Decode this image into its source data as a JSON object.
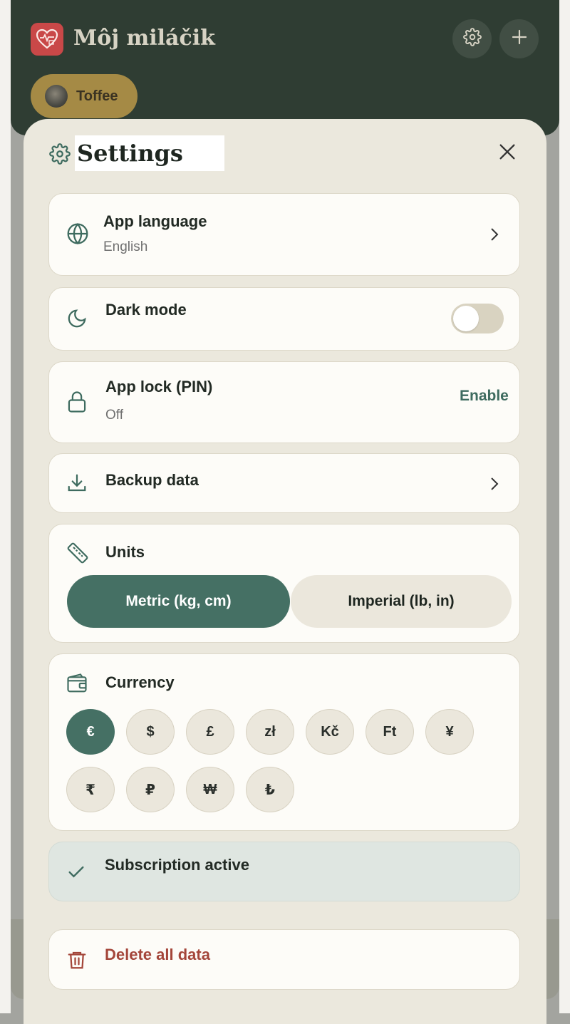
{
  "app": {
    "title": "Môj miláčik"
  },
  "header": {
    "settings_icon": "gear-icon",
    "add_icon": "plus-icon"
  },
  "pet": {
    "name": "Toffee"
  },
  "settings": {
    "title": "Settings",
    "language": {
      "label": "App language",
      "value": "English"
    },
    "dark_mode": {
      "label": "Dark mode",
      "enabled": false
    },
    "app_lock": {
      "label": "App lock (PIN)",
      "status": "Off",
      "action": "Enable"
    },
    "backup": {
      "label": "Backup data"
    },
    "units": {
      "label": "Units",
      "options": [
        "Metric (kg, cm)",
        "Imperial (lb, in)"
      ],
      "selected": "Metric (kg, cm)"
    },
    "currency": {
      "label": "Currency",
      "options": [
        "€",
        "$",
        "£",
        "zł",
        "Kč",
        "Ft",
        "¥",
        "₹",
        "₽",
        "₩",
        "₺"
      ],
      "selected": "€"
    },
    "subscription": {
      "label": "Subscription active"
    },
    "delete": {
      "label": "Delete all data"
    }
  },
  "colors": {
    "accent": "#457064",
    "header": "#2f3d33",
    "danger": "#a4463a",
    "pet_chip": "#a58a45"
  }
}
